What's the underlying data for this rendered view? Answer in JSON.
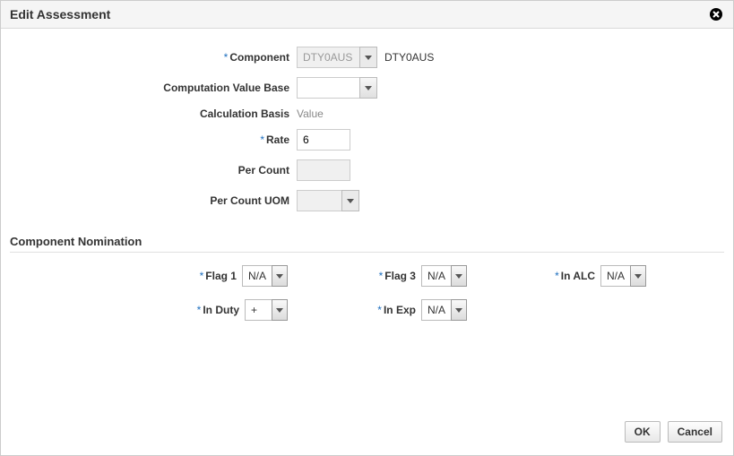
{
  "dialog": {
    "title": "Edit Assessment"
  },
  "form": {
    "component": {
      "label": "Component",
      "value": "DTY0AUS",
      "display": "DTY0AUS"
    },
    "comp_value_base": {
      "label": "Computation Value Base",
      "value": ""
    },
    "calc_basis": {
      "label": "Calculation Basis",
      "value": "Value"
    },
    "rate": {
      "label": "Rate",
      "value": "6"
    },
    "per_count": {
      "label": "Per Count",
      "value": ""
    },
    "per_count_uom": {
      "label": "Per Count UOM",
      "value": ""
    }
  },
  "section": {
    "title": "Component Nomination"
  },
  "nom": {
    "flag1": {
      "label": "Flag 1",
      "value": "N/A"
    },
    "flag3": {
      "label": "Flag 3",
      "value": "N/A"
    },
    "in_alc": {
      "label": "In ALC",
      "value": "N/A"
    },
    "in_duty": {
      "label": "In Duty",
      "value": "+"
    },
    "in_exp": {
      "label": "In Exp",
      "value": "N/A"
    }
  },
  "buttons": {
    "ok": "OK",
    "cancel": "Cancel"
  }
}
